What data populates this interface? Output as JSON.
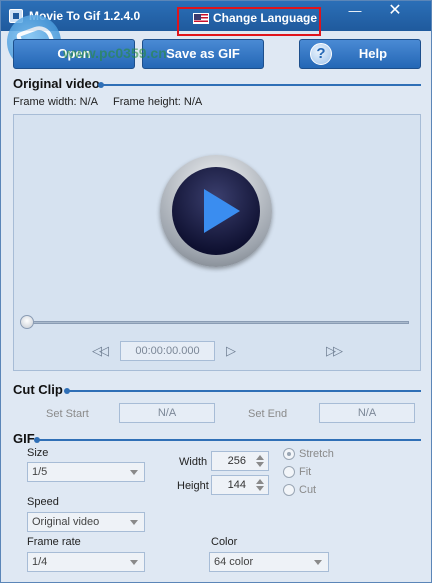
{
  "window": {
    "title": "Movie To Gif 1.2.4.0",
    "change_language": "Change Language",
    "minimize": "—",
    "close": "✕"
  },
  "watermark": {
    "text": "www.pc0359.cn"
  },
  "toolbar": {
    "open": "Open",
    "save_as_gif": "Save as GIF",
    "help": "Help",
    "help_icon": "?"
  },
  "original_video": {
    "title": "Original video",
    "frame_width": "Frame width: N/A",
    "frame_height": "Frame height: N/A",
    "timecode": "00:00:00.000",
    "seek_position": 0
  },
  "cut_clip": {
    "title": "Cut Clip",
    "set_start": "Set Start",
    "start_value": "N/A",
    "set_end": "Set End",
    "end_value": "N/A"
  },
  "gif": {
    "title": "GIF",
    "size_label": "Size",
    "size_value": "1/5",
    "width_label": "Width",
    "width_value": "256",
    "height_label": "Height",
    "height_value": "144",
    "stretch": "Stretch",
    "fit": "Fit",
    "cut": "Cut",
    "selected_mode": "Stretch",
    "speed_label": "Speed",
    "speed_value": "Original video",
    "frame_rate_label": "Frame rate",
    "frame_rate_value": "1/4",
    "color_label": "Color",
    "color_value": "64 color"
  },
  "colors": {
    "accent": "#2467b5",
    "highlight_box": "#e0141b"
  }
}
